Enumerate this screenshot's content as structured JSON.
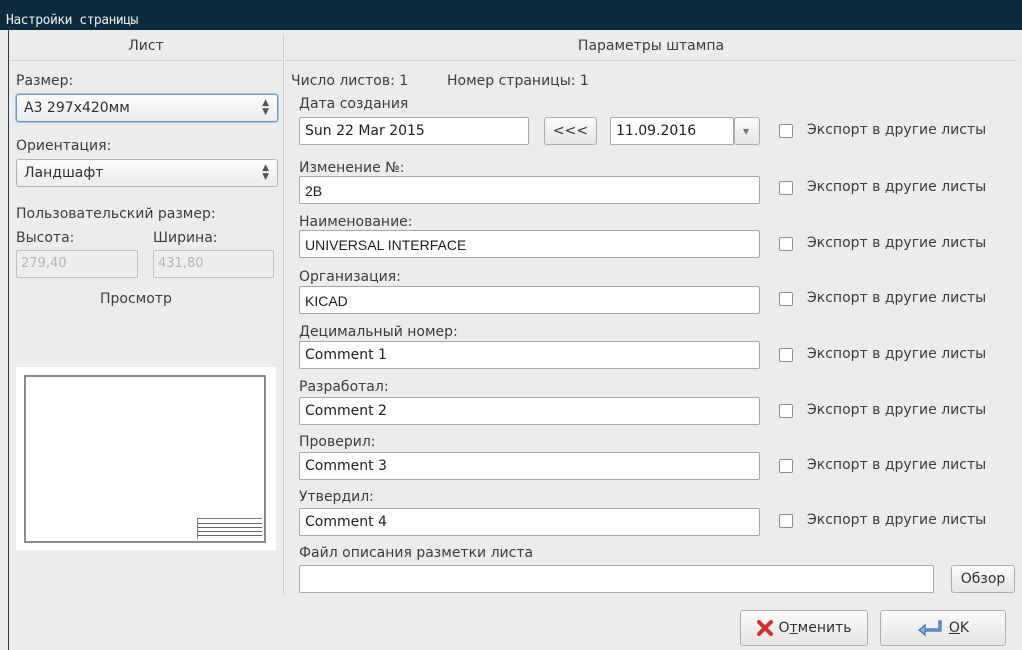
{
  "window": {
    "title": "Настройки страницы"
  },
  "left": {
    "header": "Лист",
    "size_label": "Размер:",
    "size_value": "A3 297x420мм",
    "orientation_label": "Ориентация:",
    "orientation_value": "Ландшафт",
    "custom_size_label": "Пользовательский размер:",
    "height_label": "Высота:",
    "width_label": "Ширина:",
    "height_value": "279,40",
    "width_value": "431,80",
    "preview_label": "Просмотр"
  },
  "right": {
    "header": "Параметры штампа",
    "sheet_count": "Число листов: 1",
    "page_number": "Номер страницы: 1",
    "date_label": "Дата создания",
    "date_value": "Sun 22 Mar 2015",
    "copy_date_button": "<<<",
    "date_picker_value": "11.09.2016",
    "export_label": "Экспорт в другие листы",
    "fields": [
      {
        "label": "Изменение №:",
        "value": "2B"
      },
      {
        "label": "Наименование:",
        "value": "UNIVERSAL INTERFACE"
      },
      {
        "label": "Организация:",
        "value": "KICAD"
      },
      {
        "label": "Децимальный номер:",
        "value": "Comment 1"
      },
      {
        "label": "Разработал:",
        "value": "Comment 2"
      },
      {
        "label": "Проверил:",
        "value": "Comment 3"
      },
      {
        "label": "Утвердил:",
        "value": "Comment 4"
      }
    ],
    "layout_file_label": "Файл описания разметки листа",
    "layout_file_value": "",
    "browse_button": "Обзор"
  },
  "buttons": {
    "cancel_pre": "О",
    "cancel_mnemonic": "т",
    "cancel_post": "менить",
    "ok_mnemonic": "О",
    "ok_post": "K"
  },
  "colors": {
    "titlebar": "#0c2b3a",
    "background": "#edeceb",
    "cancel_icon": "#d03030",
    "ok_icon": "#3b6fb3"
  }
}
